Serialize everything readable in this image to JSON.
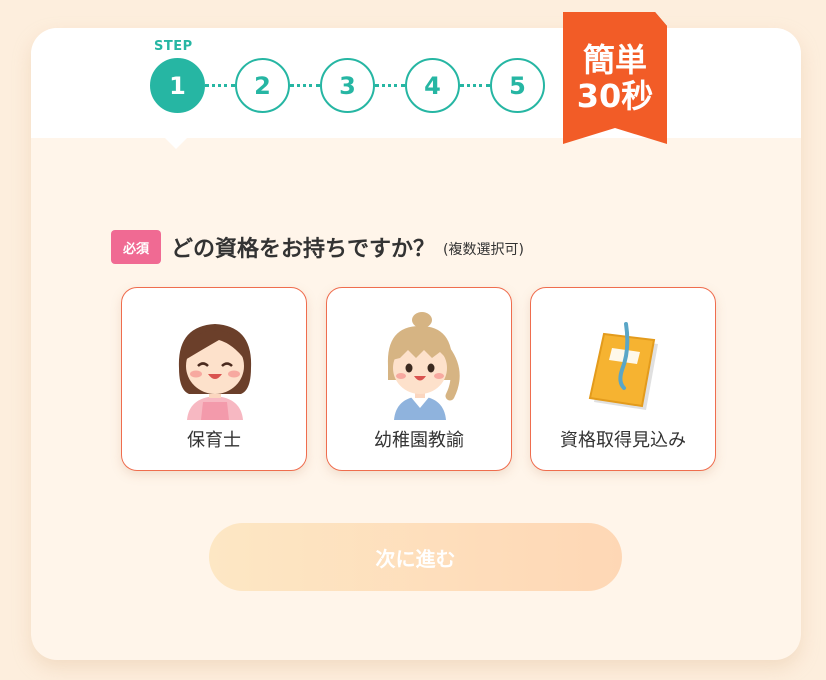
{
  "progress": {
    "step_label": "STEP",
    "steps": [
      "1",
      "2",
      "3",
      "4",
      "5"
    ],
    "current_step": 1
  },
  "badge": {
    "line1": "簡単",
    "line2": "30秒",
    "color": "#f25c27"
  },
  "question": {
    "required_label": "必須",
    "text": "どの資格をお持ちですか？",
    "note": "(複数選択可)"
  },
  "options": [
    {
      "label": "保育士",
      "icon": "nursery-teacher-icon"
    },
    {
      "label": "幼稚園教諭",
      "icon": "kindergarten-teacher-icon"
    },
    {
      "label": "資格取得見込み",
      "icon": "notebook-icon"
    }
  ],
  "next_button": {
    "label": "次に進む",
    "enabled": false
  },
  "colors": {
    "accent": "#26b6a3",
    "option_border": "#ef6d4e",
    "required": "#f06a93",
    "background": "#fdeedd"
  }
}
